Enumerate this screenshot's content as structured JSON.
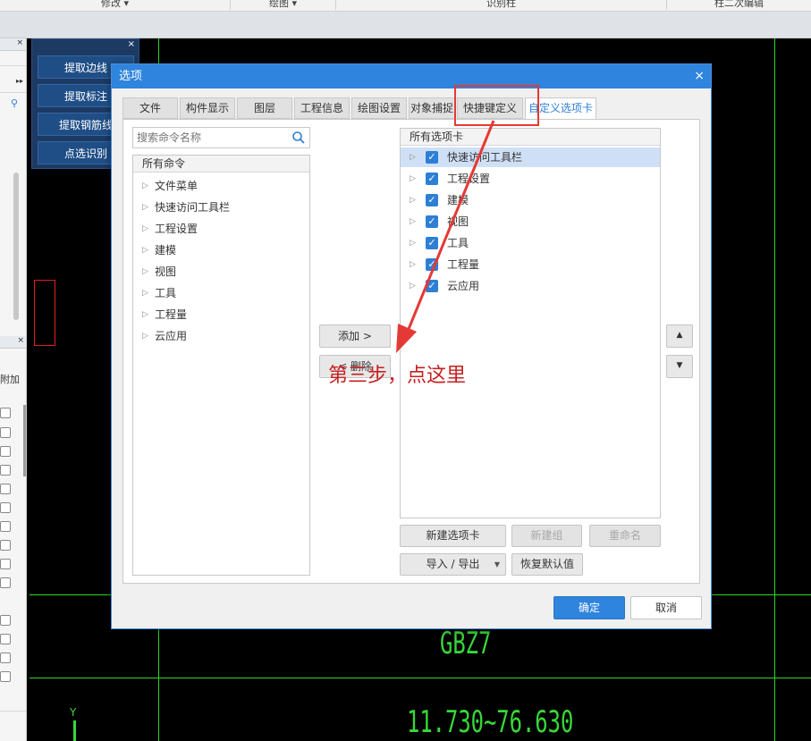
{
  "ribbon": {
    "groups": [
      "修改 ▾",
      "绘图 ▾",
      "识别柱",
      "柱二次编辑"
    ]
  },
  "float_toolbar": {
    "close": "×",
    "buttons": [
      "提取边线",
      "提取标注",
      "提取钢筋线",
      "点选识别"
    ]
  },
  "drawing": {
    "label_id": "GBZ7",
    "label_range": "11.730~76.630",
    "axis_y": "Y"
  },
  "dialog": {
    "title": "选项",
    "close": "×",
    "tabs": [
      "文件",
      "构件显示",
      "图层",
      "工程信息",
      "绘图设置",
      "对象捕捉",
      "快捷键定义",
      "自定义选项卡"
    ],
    "active_tab": "自定义选项卡",
    "search_placeholder": "搜索命令名称",
    "left_tree": {
      "header": "所有命令",
      "items": [
        "文件菜单",
        "快速访问工具栏",
        "工程设置",
        "建模",
        "视图",
        "工具",
        "工程量",
        "云应用"
      ]
    },
    "right_tree": {
      "header": "所有选项卡",
      "items": [
        {
          "label": "快速访问工具栏",
          "checked": true,
          "selected": true
        },
        {
          "label": "工程设置",
          "checked": true,
          "selected": false
        },
        {
          "label": "建模",
          "checked": true,
          "selected": false
        },
        {
          "label": "视图",
          "checked": true,
          "selected": false
        },
        {
          "label": "工具",
          "checked": true,
          "selected": false
        },
        {
          "label": "工程量",
          "checked": true,
          "selected": false
        },
        {
          "label": "云应用",
          "checked": true,
          "selected": false
        }
      ]
    },
    "add_button": "添加 >",
    "remove_button": "< 删除",
    "new_tab_button": "新建选项卡",
    "new_group_button": "新建组",
    "rename_button": "重命名",
    "import_export_button": "导入 / 导出",
    "restore_default_button": "恢复默认值",
    "ok_button": "确定",
    "cancel_button": "取消"
  },
  "annotation": {
    "text": "第三步，点这里",
    "color": "#c62020"
  },
  "colors": {
    "accent": "#2f84dd",
    "cad_line": "#2fd52f",
    "toolbar_bg": "#1d3a63"
  }
}
